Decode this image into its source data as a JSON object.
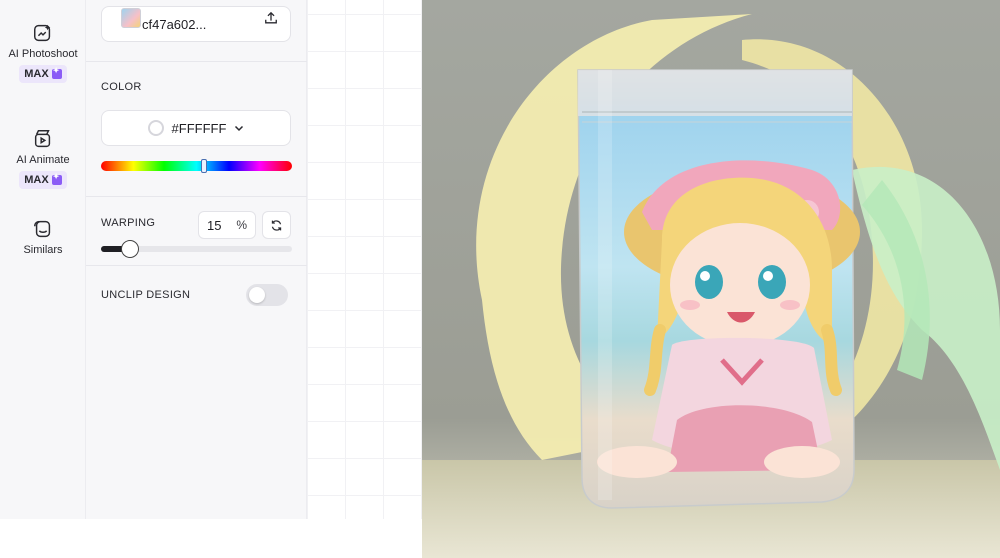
{
  "rail": {
    "items": [
      {
        "label": "AI Photoshoot",
        "badge": "MAX",
        "icon": "photoshoot-icon"
      },
      {
        "label": "AI Animate",
        "badge": "MAX",
        "icon": "animate-icon"
      },
      {
        "label": "Similars",
        "badge": "",
        "icon": "similars-icon"
      }
    ]
  },
  "panel": {
    "file_name": "cf47a602...",
    "color_label": "COLOR",
    "color_hex": "#FFFFFF",
    "hue_position": 0.54,
    "warping_label": "WARPING",
    "warping_value": "15",
    "warping_unit": "%",
    "warping_fraction": 0.15,
    "unclip_label": "UNCLIP DESIGN",
    "unclip_enabled": false
  },
  "colors": {
    "accent_max": "#8b5cf6",
    "panel_bg": "#f7f7f9"
  }
}
